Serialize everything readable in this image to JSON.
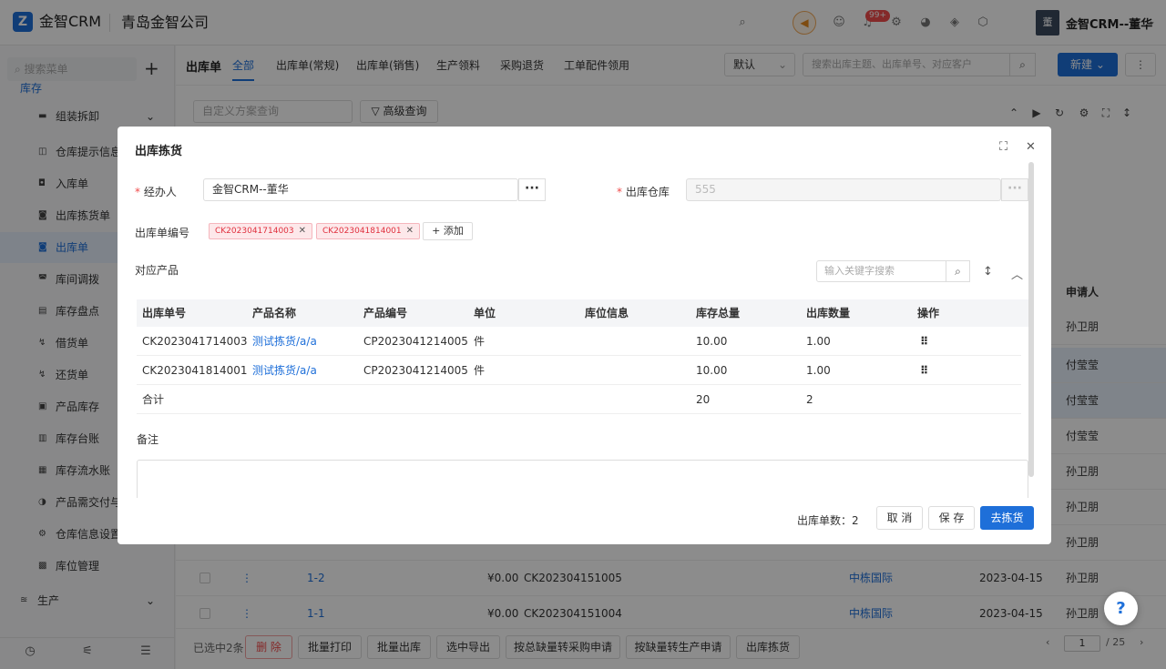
{
  "topbar": {
    "logo_letter": "Z",
    "brand": "金智CRM",
    "company": "青岛金智公司",
    "badge": "99+",
    "user": "金智CRM--董华",
    "user_initial": "董"
  },
  "sidebar": {
    "search_placeholder": "搜索菜单",
    "parent": "库存",
    "items": [
      {
        "label": "组装拆卸",
        "icon": "▬"
      },
      {
        "label": "仓库提示信息",
        "icon": "◫"
      },
      {
        "label": "入库单",
        "icon": "◘"
      },
      {
        "label": "出库拣货单",
        "icon": "◙"
      },
      {
        "label": "出库单",
        "icon": "◙"
      },
      {
        "label": "库间调拨",
        "icon": "◚"
      },
      {
        "label": "库存盘点",
        "icon": "▤"
      },
      {
        "label": "借货单",
        "icon": "↯"
      },
      {
        "label": "还货单",
        "icon": "↯"
      },
      {
        "label": "产品库存",
        "icon": "▣"
      },
      {
        "label": "库存台账",
        "icon": "▥"
      },
      {
        "label": "库存流水账",
        "icon": "▦"
      },
      {
        "label": "产品需交付与",
        "icon": "◑"
      },
      {
        "label": "仓库信息设置",
        "icon": "⚙"
      },
      {
        "label": "库位管理",
        "icon": "▩"
      }
    ],
    "production": "生产"
  },
  "main": {
    "title": "出库单",
    "tabs": [
      "全部",
      "出库单(常规)",
      "出库单(销售)",
      "生产领料",
      "采购退货",
      "工单配件领用"
    ],
    "view_select": "默认",
    "search_placeholder": "搜索出库主题、出库单号、对应客户",
    "new_button": "新建",
    "scheme_placeholder": "自定义方案查询",
    "advanced_query": "高级查询",
    "applicant_header": "申请人",
    "applicants": [
      "孙卫朋",
      "付莹莹",
      "付莹莹",
      "付莹莹",
      "孙卫朋",
      "孙卫朋",
      "孙卫朋",
      "孙卫朋",
      "孙卫朋"
    ],
    "visible_rows": [
      {
        "no": "1-2",
        "amount": "¥0.00",
        "code": "CK202304151005",
        "customer": "中栋国际",
        "date": "2023-04-15",
        "applicant": "孙卫朋"
      },
      {
        "no": "1-1",
        "amount": "¥0.00",
        "code": "CK202304151004",
        "customer": "中栋国际",
        "date": "2023-04-15",
        "applicant": "孙卫朋"
      }
    ],
    "bottom": {
      "selected": "已选中2条",
      "buttons": [
        "删 除",
        "批量打印",
        "批量出库",
        "选中导出",
        "按总缺量转采购申请",
        "按缺量转生产申请",
        "出库拣货"
      ],
      "page": "1",
      "total_pages": "/ 25"
    }
  },
  "modal": {
    "title": "出库拣货",
    "handler_label": "经办人",
    "handler_value": "金智CRM--董华",
    "warehouse_label": "出库仓库",
    "warehouse_value": "555",
    "order_no_label": "出库单编号",
    "tags": [
      "CK2023041714003",
      "CK2023041814001"
    ],
    "add_label": "添加",
    "products_label": "对应产品",
    "keyword_placeholder": "输入关键字搜索",
    "table": {
      "headers": [
        "出库单号",
        "产品名称",
        "产品编号",
        "单位",
        "库位信息",
        "库存总量",
        "出库数量",
        "操作"
      ],
      "rows": [
        {
          "order": "CK2023041714003",
          "name": "测试拣货/a/a",
          "code": "CP2023041214005",
          "unit": "件",
          "location": "",
          "stock": "10.00",
          "qty": "1.00"
        },
        {
          "order": "CK2023041814001",
          "name": "测试拣货/a/a",
          "code": "CP2023041214005",
          "unit": "件",
          "location": "",
          "stock": "10.00",
          "qty": "1.00"
        }
      ],
      "total_label": "合计",
      "total_stock": "20",
      "total_qty": "2"
    },
    "remark_label": "备注",
    "count_text": "出库单数：2",
    "cancel": "取 消",
    "save": "保 存",
    "confirm": "去拣货"
  }
}
